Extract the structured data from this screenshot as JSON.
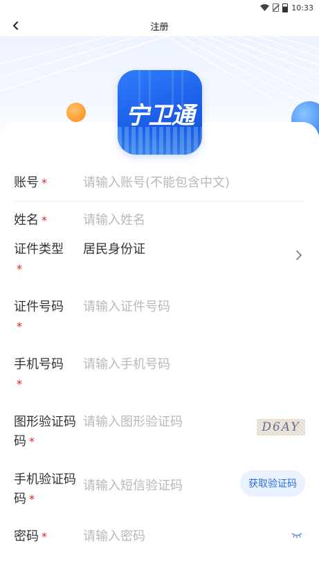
{
  "status_bar": {
    "time": "10:33"
  },
  "nav": {
    "title": "注册"
  },
  "logo": {
    "text": "宁卫通"
  },
  "form": {
    "fields": [
      {
        "label": "账号",
        "placeholder": "请输入账号(不能包含中文)"
      },
      {
        "label": "姓名",
        "placeholder": "请输入姓名"
      },
      {
        "label": "证件类型",
        "value": "居民身份证"
      },
      {
        "label": "证件号码",
        "placeholder": "请输入证件号码"
      },
      {
        "label": "手机号码",
        "placeholder": "请输入手机号码"
      },
      {
        "label": "图形验证码",
        "placeholder": "请输入图形验证码",
        "captcha_text": "D6AY"
      },
      {
        "label": "手机验证码",
        "placeholder": "请输入短信验证码",
        "button": "获取验证码"
      },
      {
        "label": "密码",
        "placeholder": "请输入密码"
      }
    ],
    "required_mark": "*"
  },
  "colors": {
    "accent": "#2a6fe0",
    "required": "#e02020",
    "logo_bg": "#1b5ee8"
  },
  "icons": [
    "wifi-icon",
    "no-sim-icon",
    "battery-icon",
    "back-arrow-icon",
    "chevron-right-icon",
    "eye-closed-icon"
  ]
}
